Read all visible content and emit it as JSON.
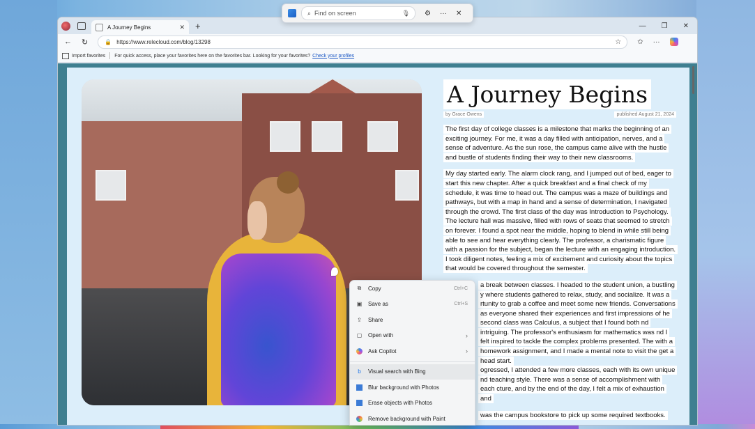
{
  "find_bar": {
    "placeholder": "Find on screen"
  },
  "browser": {
    "tab_title": "A Journey Begins",
    "url": "https://www.relecloud.com/blog/13298",
    "favorites": {
      "import_label": "Import favorites",
      "hint": "For quick access, place your favorites here on the favorites bar. Looking for your favorites?",
      "link": "Check your profiles"
    }
  },
  "article": {
    "title": "A Journey Begins",
    "author": "by Grace Owens",
    "published": "published August 21, 2024",
    "p1": "The first day of college classes is a milestone that marks the beginning of an exciting journey. For me, it was a day filled with anticipation, nerves, and a sense of adventure. As the sun rose, the campus came alive with the hustle and bustle of students finding their way to their new classrooms.",
    "p2": "My day started early. The alarm clock rang, and I jumped out of bed, eager to start this new chapter. After a quick breakfast and a final check of my schedule, it was time to head out. The campus was a maze of buildings and pathways, but with a map in hand and a sense of determination, I navigated through the crowd. The first class of the day was Introduction to Psychology. The lecture hall was massive, filled with rows of seats that seemed to stretch on forever. I found a spot near the middle, hoping to blend in while still being able to see and hear everything clearly. The professor, a charismatic figure with a passion for the subject, began the lecture with an engaging introduction. I took diligent notes, feeling a mix of excitement and curiosity about the topics that would be covered throughout the semester.",
    "p3": "a break between classes. I headed to the student union, a bustling y where students gathered to relax, study, and socialize. It was a rtunity to grab a coffee and meet some new friends. Conversations as everyone shared their experiences and first impressions of he second class was Calculus, a subject that I found both nd intriguing. The professor's enthusiasm for mathematics was nd I felt inspired to tackle the complex problems presented. The with a homework assignment, and I made a mental note to visit the get a head start.",
    "p4": "ogressed, I attended a few more classes, each with its own unique nd teaching style. There was a sense of accomplishment with each cture, and by the end of the day, I felt a mix of exhaustion and",
    "p5": "was the campus bookstore to pick up some required textbooks."
  },
  "context_menu": {
    "items": [
      {
        "label": "Copy",
        "shortcut": "Ctrl+C"
      },
      {
        "label": "Save as",
        "shortcut": "Ctrl+S"
      },
      {
        "label": "Share"
      },
      {
        "label": "Open with"
      },
      {
        "label": "Ask Copilot"
      },
      {
        "label": "Visual search with Bing"
      },
      {
        "label": "Blur background with Photos"
      },
      {
        "label": "Erase objects with Photos"
      },
      {
        "label": "Remove background with Paint"
      }
    ]
  }
}
